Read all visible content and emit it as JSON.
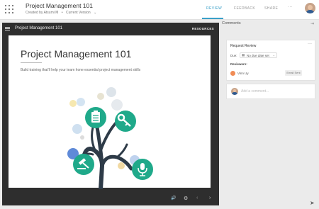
{
  "header": {
    "title": "Project Management 101",
    "created_by": "Created by Atsumi M",
    "version_label": "Current Version",
    "tabs": [
      "REVIEW",
      "FEEDBACK",
      "SHARE"
    ],
    "more": "···"
  },
  "player": {
    "title": "Project Management 101",
    "resources_label": "RESOURCES",
    "slide": {
      "title": "Project Management 101",
      "description": "Build training that'll help your team hone essential project management skills"
    },
    "controls": {
      "volume": "🔊",
      "settings": "⚙",
      "prev": "‹",
      "next": "›"
    }
  },
  "comments": {
    "header": "Comments",
    "collapse_icon": "⇥",
    "request_review": {
      "title": "Request Review",
      "more": "···",
      "due_label": "Due:",
      "due_value": "No due date set",
      "reviewers_label": "Reviewers:",
      "reviewer": {
        "name": "Vinn Uy",
        "status": "Email Sent"
      }
    },
    "add_comment_placeholder": "Add a comment..."
  },
  "colors": {
    "accent": "#3aa0c8",
    "teal": "#1fa98a",
    "player_bg": "#2e2e2e",
    "reviewer_avatar": "#f08c55"
  }
}
